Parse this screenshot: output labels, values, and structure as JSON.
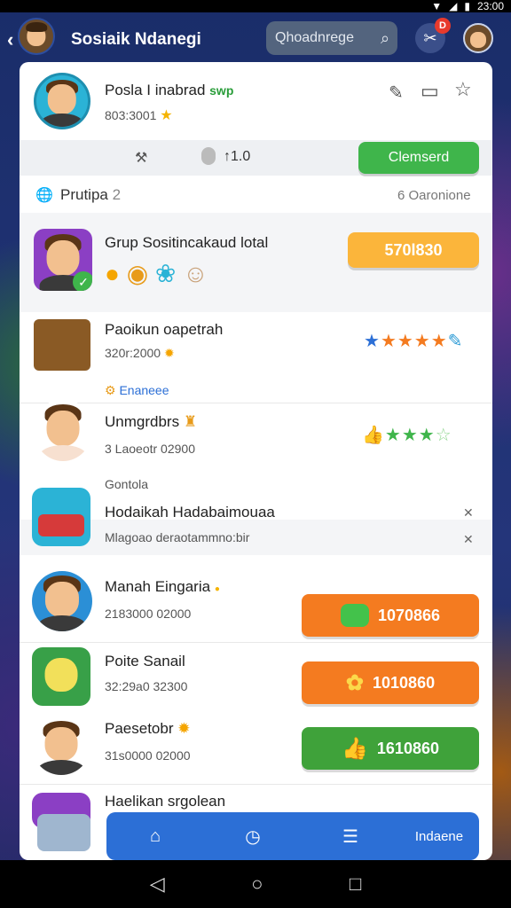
{
  "status": {
    "time": "23:00"
  },
  "header": {
    "title": "Sosiaik Ndanegi",
    "search_value": "Qhoadnrege"
  },
  "notifications": {
    "badge": "D"
  },
  "profile": {
    "name": "Posla I inabrad",
    "tag": "swp",
    "sub": "803:3001",
    "star": "★"
  },
  "filterbar": {
    "left_icon": "⚒",
    "middle": "↑1.0",
    "button": "Clemserd"
  },
  "section": {
    "title": "Prutipa",
    "count": "2",
    "right": "6 Oaronione"
  },
  "group": {
    "title": "Grup Sositincakaud lotal",
    "button": "570l830"
  },
  "items": [
    {
      "title": "Paoikun oapetrah",
      "sub": "320r:2000"
    },
    {
      "label": "Enaneee"
    },
    {
      "title": "Unmgrdbrs",
      "sub": "3 Laoeotr 02900"
    },
    {
      "label": "Gontola"
    },
    {
      "title": "Hodaikah Hadabaimouaa",
      "sub": "Mlagoao deraotammno:bir"
    },
    {
      "title": "Manah Eingaria",
      "sub": "2183000 02000",
      "button": "1070866"
    },
    {
      "title": "Poite Sanail",
      "sub": "32:29a0 32300",
      "button": "1010860"
    },
    {
      "title": "Paesetobr",
      "sub": "31s0000 02000",
      "button": "1610860"
    },
    {
      "title": "Haelikan srgolean"
    }
  ],
  "bottomnav": {
    "label": "Indaene"
  },
  "colors": {
    "green": "#3fb54b",
    "orange": "#f47b20",
    "yellow": "#fbb53b",
    "blue": "#2c6fd6"
  }
}
